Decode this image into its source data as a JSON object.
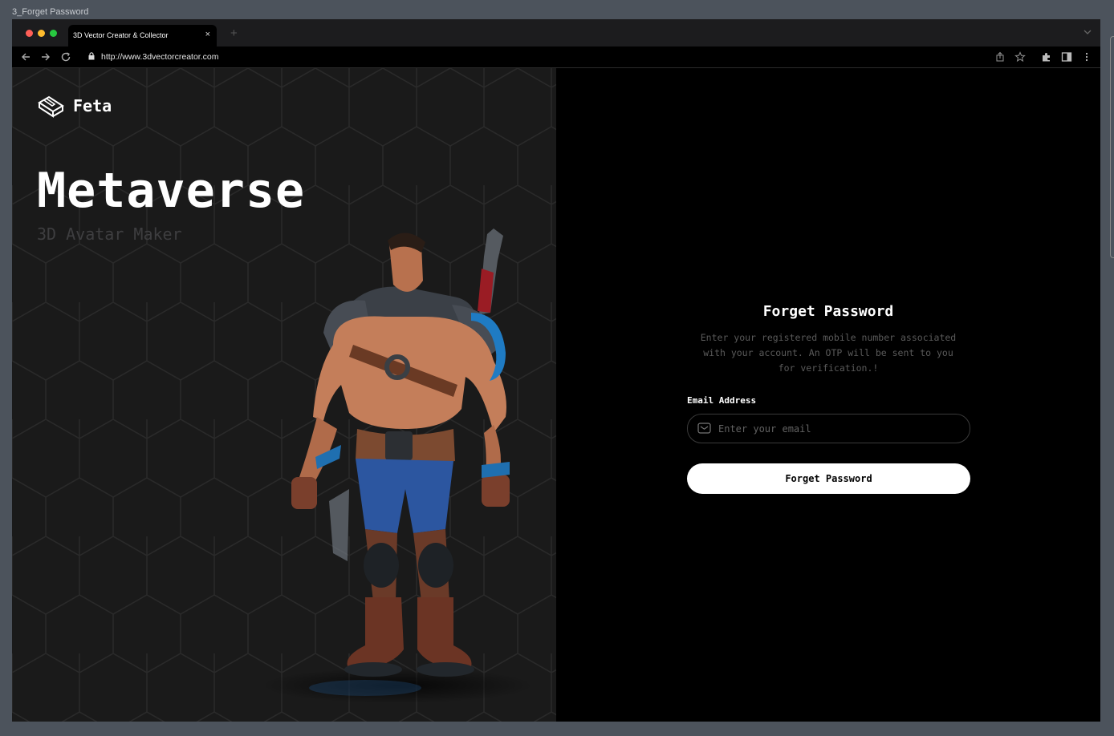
{
  "frame_label": "3_Forget Password",
  "browser": {
    "traffic_lights": [
      "#ff5f57",
      "#febc2e",
      "#28c840"
    ],
    "tab_title": "3D Vector Creator & Collector",
    "tab_close": "×",
    "new_tab": "+",
    "url": "http://www.3dvectorcreator.com"
  },
  "brand": {
    "name": "Feta"
  },
  "hero": {
    "title": "Metaverse",
    "subtitle": "3D Avatar Maker"
  },
  "form": {
    "title": "Forget Password",
    "description": "Enter your registered mobile number associated with your account. An OTP will be sent to you for verification.!",
    "email_label": "Email Address",
    "email_placeholder": "Enter your email",
    "email_icon": "mail-icon",
    "submit_label": "Forget Password"
  },
  "colors": {
    "left_panel": "#1a1a1a",
    "right_panel": "#000000",
    "button_bg": "#ffffff",
    "muted_text": "#5a5a5a"
  }
}
